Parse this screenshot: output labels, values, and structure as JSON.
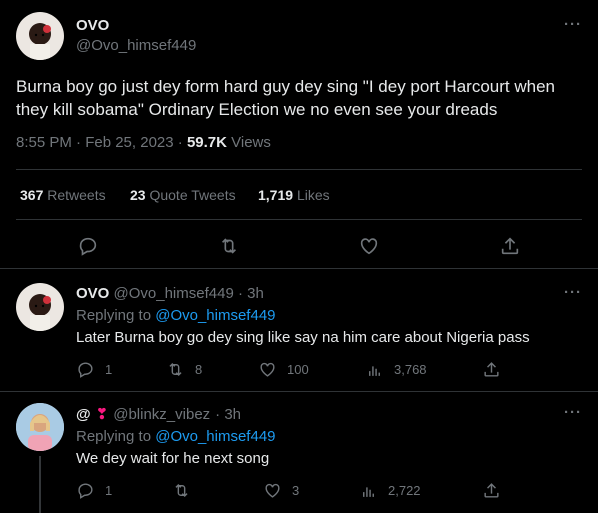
{
  "main_tweet": {
    "display_name": "OVO",
    "handle": "@Ovo_himsef449",
    "text": "Burna boy go just dey form hard guy dey sing \"I dey port Harcourt when they kill sobama\" Ordinary Election we no even see your dreads",
    "timestamp": "8:55 PM · Feb 25, 2023 ·",
    "views_count": "59.7K",
    "views_label": "Views",
    "retweets_count": "367",
    "retweets_label": "Retweets",
    "quotes_count": "23",
    "quotes_label": "Quote Tweets",
    "likes_count": "1,719",
    "likes_label": "Likes",
    "more": "···"
  },
  "replies": [
    {
      "display_name": "OVO",
      "handle": "@Ovo_himsef449",
      "time": "· 3h",
      "replying_prefix": "Replying to",
      "replying_to": "@Ovo_himsef449",
      "text": "Later Burna boy go dey sing like say na him care about Nigeria pass",
      "replies": "1",
      "retweets": "8",
      "likes": "100",
      "views": "3,768",
      "more": "···"
    },
    {
      "display_name": "@",
      "handle": "@blinkz_vibez",
      "time": "· 3h",
      "replying_prefix": "Replying to",
      "replying_to": "@Ovo_himsef449",
      "text": "We dey wait for he next song",
      "replies": "1",
      "retweets": "",
      "likes": "3",
      "views": "2,722",
      "more": "···"
    }
  ],
  "icons": [
    "reply-icon",
    "retweet-icon",
    "like-icon",
    "views-icon",
    "share-icon",
    "heart-emoji-icon"
  ],
  "colors": {
    "background": "#000000",
    "text": "#e7e9ea",
    "muted": "#71767b",
    "link": "#1d9bf0",
    "divider": "#2f3336",
    "heart": "#f91880"
  }
}
